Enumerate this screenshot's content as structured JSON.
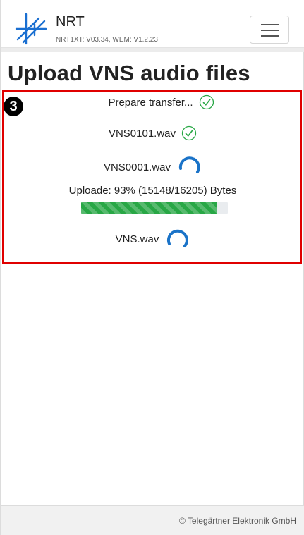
{
  "header": {
    "brand": "NRT",
    "version": "NRT1XT: V03.34, WEM: V1.2.23",
    "menu_icon": "hamburger-menu-icon"
  },
  "page": {
    "title": "Upload VNS audio files",
    "step_number": "3"
  },
  "transfer": {
    "prepare": {
      "label": "Prepare transfer...",
      "status": "done",
      "icon": "check-circle-icon"
    },
    "files": [
      {
        "name": "VNS0101.wav",
        "status": "done",
        "icon": "check-circle-icon"
      },
      {
        "name": "VNS0001.wav",
        "status": "uploading",
        "icon": "spinner-icon"
      },
      {
        "name": "VNS.wav",
        "status": "pending",
        "icon": "spinner-icon"
      }
    ],
    "progress_text": "Uploade: 93% (15148/16205) Bytes",
    "progress_fraction": 0.93
  },
  "colors": {
    "success": "#28a745",
    "spinner": "#1a73c8",
    "highlight": "#e00000",
    "logo": "#1a6fd1"
  },
  "footer": {
    "copyright": "© Telegärtner Elektronik GmbH"
  }
}
